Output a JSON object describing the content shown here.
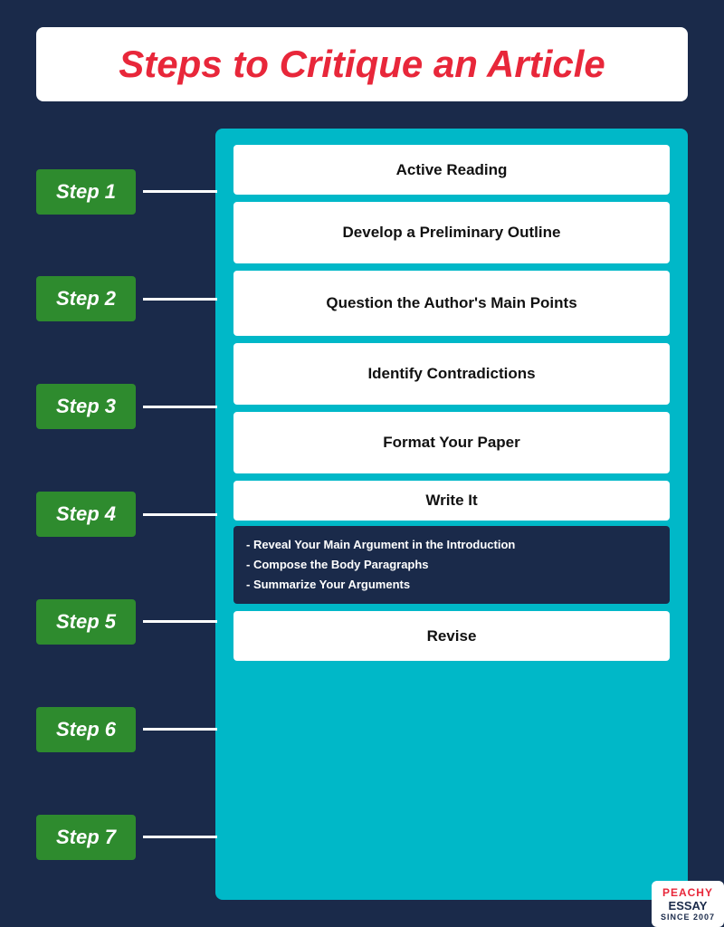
{
  "title": "Steps to Critique an Article",
  "steps": [
    {
      "label": "Step 1"
    },
    {
      "label": "Step 2"
    },
    {
      "label": "Step 3"
    },
    {
      "label": "Step 4"
    },
    {
      "label": "Step 5"
    },
    {
      "label": "Step 6"
    },
    {
      "label": "Step 7"
    }
  ],
  "items": {
    "step1": "Active Reading",
    "step2": "Develop a Preliminary Outline",
    "step3": "Question the Author's Main Points",
    "step4": "Identify Contradictions",
    "step5": "Format Your Paper",
    "step6_write": "Write It",
    "step6_sub1": "- Reveal Your Main Argument in the Introduction",
    "step6_sub2": "- Compose the Body Paragraphs",
    "step6_sub3": "- Summarize Your Arguments",
    "step7": "Revise"
  },
  "logo": {
    "top": "PEACHY",
    "main": "ESSAY",
    "bottom": "SINCE 2007"
  }
}
